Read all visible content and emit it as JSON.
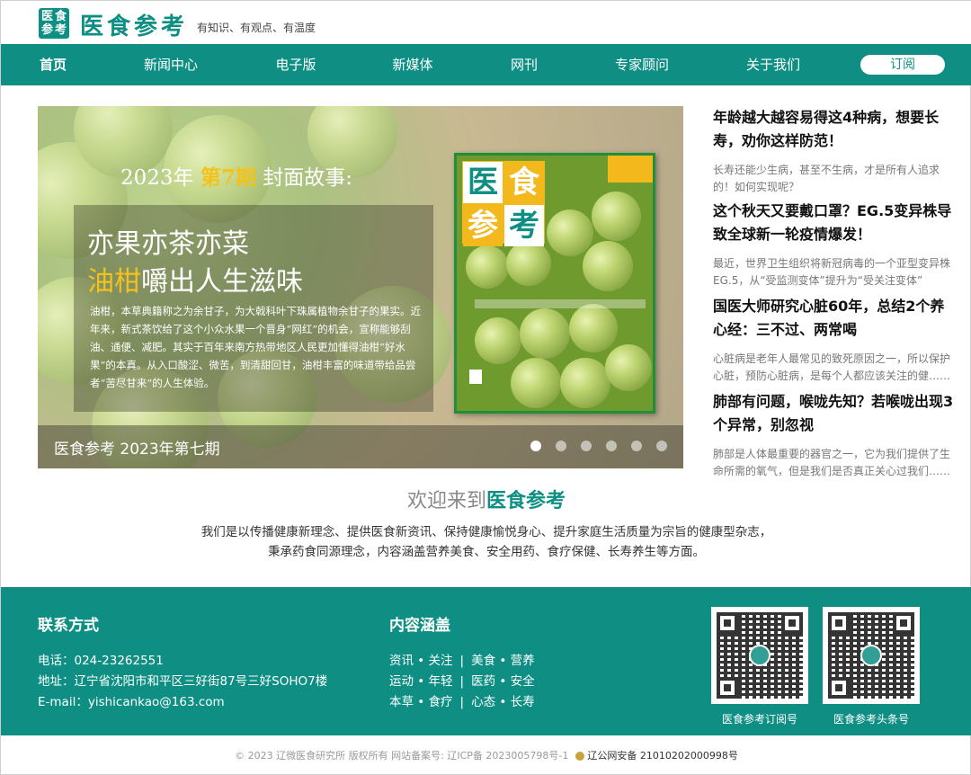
{
  "header": {
    "logo_chars": [
      "医",
      "食",
      "参",
      "考"
    ],
    "logo_text": "医食参考",
    "slogan": "有知识、有观点、有温度"
  },
  "nav": {
    "items": [
      "首页",
      "新闻中心",
      "电子版",
      "新媒体",
      "网刊",
      "专家顾问",
      "关于我们"
    ],
    "subscribe": "订阅"
  },
  "banner": {
    "issue_prefix": "2023年",
    "issue_highlight": "第7期",
    "issue_suffix": "封面故事:",
    "title_line1": "亦果亦茶亦菜",
    "title_line2_highlight": "油柑",
    "title_line2_rest": "嚼出人生滋味",
    "body": "油柑，本草典籍称之为余甘子，为大戟科叶下珠属植物余甘子的果实。近年来，新式茶饮给了这个小众水果一个晋身“网红”的机会，宣称能够刮油、通便、减肥。其实于百年来南方热带地区人民更加懂得油柑“好水果”的本真。从入口酸涩、微苦，到清甜回甘，油柑丰富的味道带给品尝者“苦尽甘来”的人生体验。",
    "caption": "医食参考 2023年第七期",
    "slide_count": 6,
    "active_slide": 1,
    "cover_logo_chars": [
      "医",
      "食",
      "参",
      "考"
    ]
  },
  "news": [
    {
      "title": "年龄越大越容易得这4种病，想要长寿，劝你这样防范！",
      "desc": "长寿还能少生病，甚至不生病，才是所有人追求的！如何实现呢？"
    },
    {
      "title": "这个秋天又要戴口罩？EG.5变异株导致全球新一轮疫情爆发！",
      "desc": "最近，世界卫生组织将新冠病毒的一个亚型变异株EG.5，从“受监测变体”提升为“受关注变体”"
    },
    {
      "title": "国医大师研究心脏60年，总结2个养心经：三不过、两常喝",
      "desc": "心脏病是老年人最常见的致死原因之一，所以保护心脏，预防心脏病，是每个人都应该关注的健……"
    },
    {
      "title": "肺部有问题，喉咙先知？若喉咙出现3个异常，别忽视",
      "desc": "肺部是人体最重要的器官之一，它为我们提供了生命所需的氧气，但是我们是否真正关心过我们……"
    }
  ],
  "welcome": {
    "prefix": "欢迎来到",
    "brand": "医食参考",
    "line1": "我们是以传播健康新理念、提供医食新资讯、保持健康愉悦身心、提升家庭生活质量为宗旨的健康型杂志，",
    "line2": "秉承药食同源理念，内容涵盖营养美食、安全用药、食疗保健、长寿养生等方面。"
  },
  "footer": {
    "contact_heading": "联系方式",
    "phone": "电话：024-23262551",
    "address": "地址：辽宁省沈阳市和平区三好街87号三好SOHO7楼",
    "email": "E-mail：yishicankao@163.com",
    "content_heading": "内容涵盖",
    "content_rows": [
      [
        "资讯 • 关注",
        "美食 • 营养"
      ],
      [
        "运动 • 年轻",
        "医药 • 安全"
      ],
      [
        "本草 • 食疗",
        "心态 • 长寿"
      ]
    ],
    "separator": "|",
    "qr1_label": "医食参考订阅号",
    "qr2_label": "医食参考头条号"
  },
  "copyright": {
    "text": "© 2023 辽微医食研究所 版权所有 网站备案号: 辽ICP备 2023005798号-1",
    "police": "辽公网安备 21010202000998号"
  },
  "colors": {
    "brand": "#0f8f84",
    "highlight": "#f4c21a"
  }
}
